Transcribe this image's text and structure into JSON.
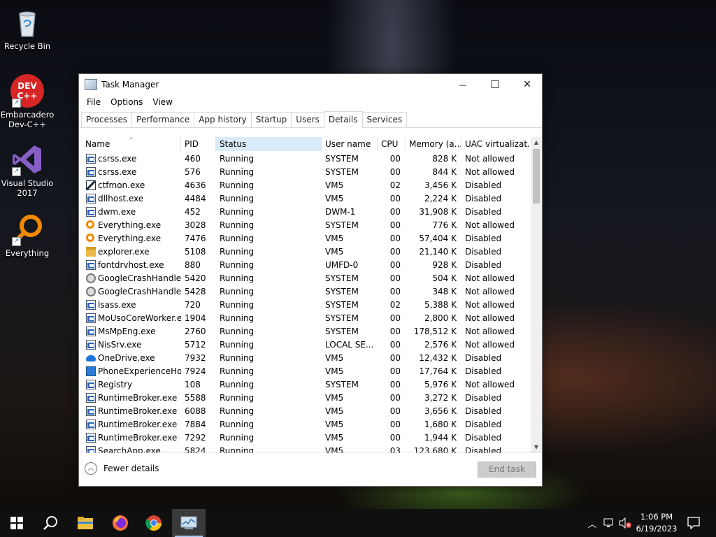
{
  "desktop": {
    "icons": [
      {
        "label_line1": "Recycle Bin",
        "label_line2": ""
      },
      {
        "label_line1": "Embarcadero",
        "label_line2": "Dev-C++"
      },
      {
        "label_line1": "Visual Studio",
        "label_line2": "2017"
      },
      {
        "label_line1": "Everything",
        "label_line2": ""
      }
    ],
    "devcpp_logo_text": "DEV C++"
  },
  "window": {
    "title": "Task Manager",
    "minimize_glyph": "—",
    "maximize_glyph": "☐",
    "close_glyph": "✕",
    "menu": [
      "File",
      "Options",
      "View"
    ],
    "tabs": [
      "Processes",
      "Performance",
      "App history",
      "Startup",
      "Users",
      "Details",
      "Services"
    ],
    "active_tab": "Details",
    "columns": [
      "Name",
      "PID",
      "Status",
      "User name",
      "CPU",
      "Memory (a...",
      "UAC virtualizat..."
    ],
    "sorted_column": "Name",
    "highlighted_column": "Status",
    "rows": [
      {
        "icon": "exe-icon",
        "name": "csrss.exe",
        "pid": "460",
        "status": "Running",
        "user": "SYSTEM",
        "cpu": "00",
        "memory": "828 K",
        "uac": "Not allowed"
      },
      {
        "icon": "exe-icon",
        "name": "csrss.exe",
        "pid": "576",
        "status": "Running",
        "user": "SYSTEM",
        "cpu": "00",
        "memory": "844 K",
        "uac": "Not allowed"
      },
      {
        "icon": "pen-icon",
        "name": "ctfmon.exe",
        "pid": "4636",
        "status": "Running",
        "user": "VM5",
        "cpu": "02",
        "memory": "3,456 K",
        "uac": "Disabled"
      },
      {
        "icon": "exe-icon",
        "name": "dllhost.exe",
        "pid": "4484",
        "status": "Running",
        "user": "VM5",
        "cpu": "00",
        "memory": "2,224 K",
        "uac": "Disabled"
      },
      {
        "icon": "exe-icon",
        "name": "dwm.exe",
        "pid": "452",
        "status": "Running",
        "user": "DWM-1",
        "cpu": "00",
        "memory": "31,908 K",
        "uac": "Disabled"
      },
      {
        "icon": "search-icon",
        "name": "Everything.exe",
        "pid": "3028",
        "status": "Running",
        "user": "SYSTEM",
        "cpu": "00",
        "memory": "776 K",
        "uac": "Not allowed"
      },
      {
        "icon": "search-icon",
        "name": "Everything.exe",
        "pid": "7476",
        "status": "Running",
        "user": "VM5",
        "cpu": "00",
        "memory": "57,404 K",
        "uac": "Disabled"
      },
      {
        "icon": "folder-icon",
        "name": "explorer.exe",
        "pid": "5108",
        "status": "Running",
        "user": "VM5",
        "cpu": "00",
        "memory": "21,140 K",
        "uac": "Disabled"
      },
      {
        "icon": "exe-icon",
        "name": "fontdrvhost.exe",
        "pid": "880",
        "status": "Running",
        "user": "UMFD-0",
        "cpu": "00",
        "memory": "928 K",
        "uac": "Disabled"
      },
      {
        "icon": "gear-icon",
        "name": "GoogleCrashHandler...",
        "pid": "5420",
        "status": "Running",
        "user": "SYSTEM",
        "cpu": "00",
        "memory": "504 K",
        "uac": "Not allowed"
      },
      {
        "icon": "gear-icon",
        "name": "GoogleCrashHandler...",
        "pid": "5428",
        "status": "Running",
        "user": "SYSTEM",
        "cpu": "00",
        "memory": "348 K",
        "uac": "Not allowed"
      },
      {
        "icon": "exe-icon",
        "name": "lsass.exe",
        "pid": "720",
        "status": "Running",
        "user": "SYSTEM",
        "cpu": "02",
        "memory": "5,388 K",
        "uac": "Not allowed"
      },
      {
        "icon": "exe-icon",
        "name": "MoUsoCoreWorker.e...",
        "pid": "1904",
        "status": "Running",
        "user": "SYSTEM",
        "cpu": "00",
        "memory": "2,800 K",
        "uac": "Not allowed"
      },
      {
        "icon": "exe-icon",
        "name": "MsMpEng.exe",
        "pid": "2760",
        "status": "Running",
        "user": "SYSTEM",
        "cpu": "00",
        "memory": "178,512 K",
        "uac": "Not allowed"
      },
      {
        "icon": "exe-icon",
        "name": "NisSrv.exe",
        "pid": "5712",
        "status": "Running",
        "user": "LOCAL SE...",
        "cpu": "00",
        "memory": "2,576 K",
        "uac": "Not allowed"
      },
      {
        "icon": "cloud-icon",
        "name": "OneDrive.exe",
        "pid": "7932",
        "status": "Running",
        "user": "VM5",
        "cpu": "00",
        "memory": "12,432 K",
        "uac": "Disabled"
      },
      {
        "icon": "phone-icon",
        "name": "PhoneExperienceHo...",
        "pid": "7924",
        "status": "Running",
        "user": "VM5",
        "cpu": "00",
        "memory": "17,764 K",
        "uac": "Disabled"
      },
      {
        "icon": "exe-icon",
        "name": "Registry",
        "pid": "108",
        "status": "Running",
        "user": "SYSTEM",
        "cpu": "00",
        "memory": "5,976 K",
        "uac": "Not allowed"
      },
      {
        "icon": "exe-icon",
        "name": "RuntimeBroker.exe",
        "pid": "5588",
        "status": "Running",
        "user": "VM5",
        "cpu": "00",
        "memory": "3,272 K",
        "uac": "Disabled"
      },
      {
        "icon": "exe-icon",
        "name": "RuntimeBroker.exe",
        "pid": "6088",
        "status": "Running",
        "user": "VM5",
        "cpu": "00",
        "memory": "3,656 K",
        "uac": "Disabled"
      },
      {
        "icon": "exe-icon",
        "name": "RuntimeBroker.exe",
        "pid": "7884",
        "status": "Running",
        "user": "VM5",
        "cpu": "00",
        "memory": "1,680 K",
        "uac": "Disabled"
      },
      {
        "icon": "exe-icon",
        "name": "RuntimeBroker.exe",
        "pid": "7292",
        "status": "Running",
        "user": "VM5",
        "cpu": "00",
        "memory": "1,944 K",
        "uac": "Disabled"
      },
      {
        "icon": "exe-icon",
        "name": "SearchApp.exe",
        "pid": "5824",
        "status": "Running",
        "user": "VM5",
        "cpu": "03",
        "memory": "123,680 K",
        "uac": "Disabled"
      }
    ],
    "footer": {
      "fewer_details": "Fewer details",
      "end_task": "End task"
    }
  },
  "taskbar": {
    "items": [
      "start-icon",
      "search-icon",
      "file-explorer-icon",
      "firefox-icon",
      "chrome-icon",
      "task-manager-icon"
    ],
    "active_item": "task-manager-icon",
    "tray_icons": [
      "chevron-up-icon",
      "network-icon",
      "volume-muted-icon"
    ],
    "time": "1:06 PM",
    "date": "6/19/2023",
    "notification_icon": "notification-icon"
  }
}
